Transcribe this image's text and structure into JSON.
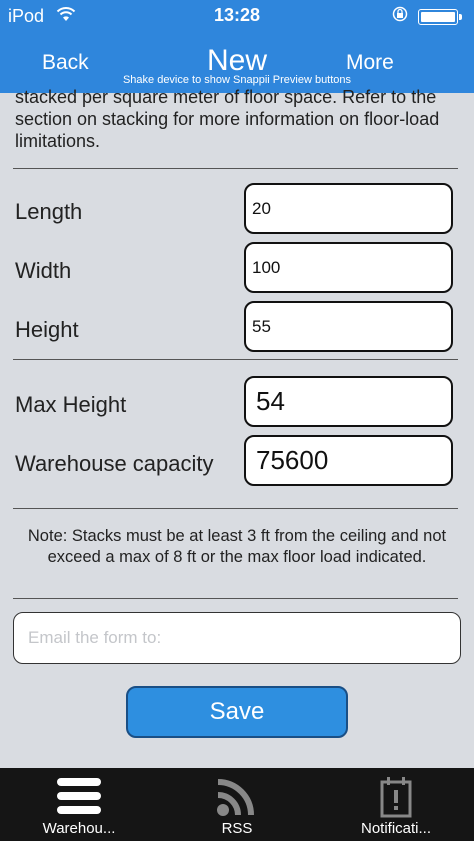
{
  "status_bar": {
    "carrier": "iPod",
    "time": "13:28"
  },
  "nav": {
    "back_label": "Back",
    "title": "New",
    "more_label": "More",
    "hint": "Shake device to show Snappii Preview buttons"
  },
  "intro_text": "stacked per square meter of floor space. Refer to the section on stacking for more information on floor-load limitations.",
  "fields": [
    {
      "label": "Length",
      "value": "20"
    },
    {
      "label": "Width",
      "value": "100"
    },
    {
      "label": "Height",
      "value": "55"
    },
    {
      "label": "Max Height",
      "value": "54"
    },
    {
      "label": "Warehouse capacity",
      "value": "75600"
    }
  ],
  "note": "Note: Stacks must be at least 3 ft from the ceiling and not exceed a max of 8 ft or the max floor load indicated.",
  "email": {
    "placeholder": "Email the form to:"
  },
  "save_label": "Save",
  "tabs": [
    {
      "label": "Warehou...",
      "icon": "menu-icon"
    },
    {
      "label": "RSS",
      "icon": "rss-icon"
    },
    {
      "label": "Notificati...",
      "icon": "notification-icon"
    }
  ],
  "colors": {
    "nav_bar": "#2f86dc",
    "save_button": "#2e8fe0",
    "tab_bar": "#151515",
    "background": "#d9dce1"
  }
}
